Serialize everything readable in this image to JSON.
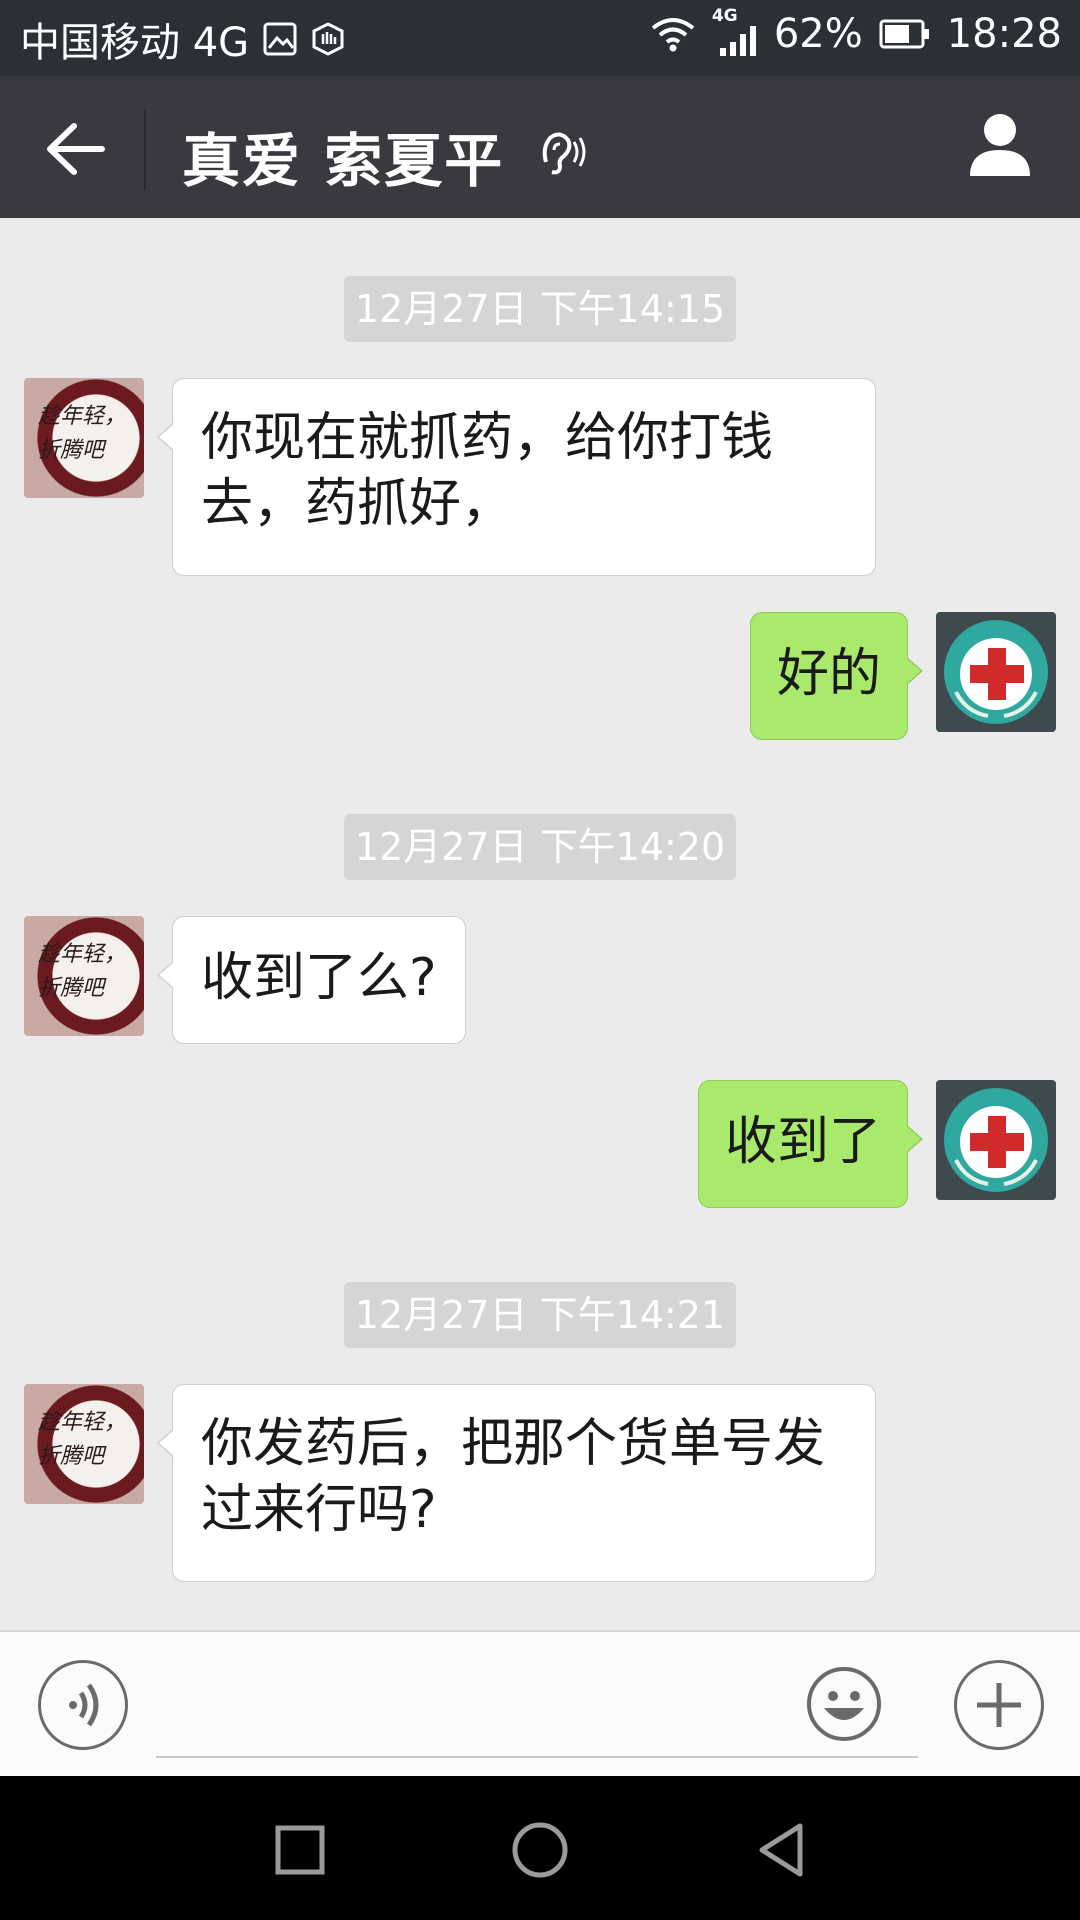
{
  "status_bar": {
    "carrier": "中国移动 4G",
    "network_small": "4G",
    "battery": "62%",
    "time": "18:28"
  },
  "header": {
    "title": "真爱 索夏平"
  },
  "messages": [
    {
      "type": "timestamp",
      "text": "12月27日 下午14:15"
    },
    {
      "type": "received",
      "text": "你现在就抓药，给你打钱去，药抓好，"
    },
    {
      "type": "sent",
      "text": "好的"
    },
    {
      "type": "timestamp",
      "text": "12月27日 下午14:20"
    },
    {
      "type": "received",
      "text": "收到了么?"
    },
    {
      "type": "sent",
      "text": "收到了"
    },
    {
      "type": "timestamp",
      "text": "12月27日 下午14:21"
    },
    {
      "type": "received",
      "text": "你发药后，把那个货单号发过来行吗?"
    }
  ],
  "avatar_other_text": "趁年轻，折腾吧",
  "input": {
    "value": "",
    "placeholder": ""
  },
  "colors": {
    "sent_bubble": "#a9e96b",
    "received_bubble": "#ffffff",
    "header": "#393a3f",
    "chat_bg": "#ebebeb"
  },
  "icons": [
    "back-arrow-icon",
    "ear-icon",
    "contact-icon",
    "voice-icon",
    "emoji-icon",
    "plus-icon",
    "square-icon",
    "circle-icon",
    "triangle-back-icon"
  ]
}
